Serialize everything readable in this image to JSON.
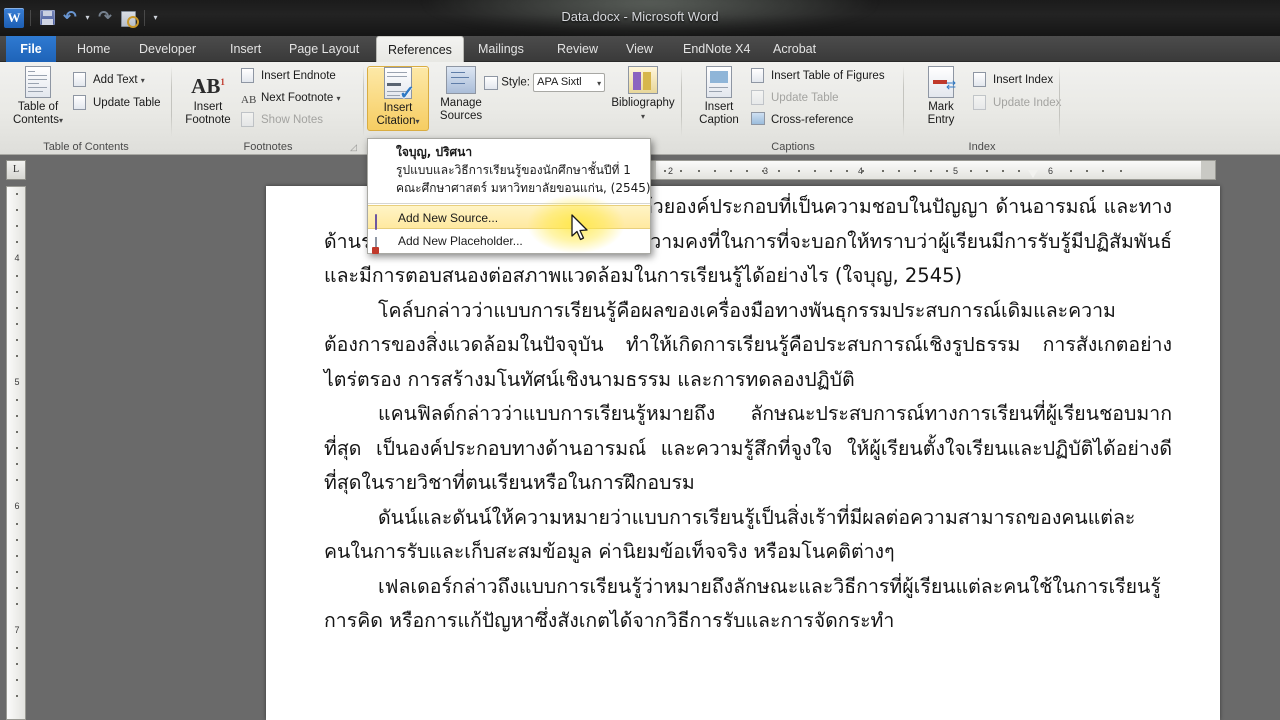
{
  "window": {
    "title": "Data.docx  -  Microsoft Word",
    "quick_access": [
      {
        "name": "word-logo",
        "label": "W"
      },
      {
        "name": "save-icon",
        "label": "Save"
      },
      {
        "name": "undo-icon",
        "label": "Undo"
      },
      {
        "name": "undo-dropdown-icon",
        "label": "▾"
      },
      {
        "name": "redo-icon",
        "label": "Redo"
      },
      {
        "name": "print-preview-icon",
        "label": "Print Preview"
      },
      {
        "name": "customize-qat-icon",
        "label": "▾"
      }
    ]
  },
  "tabs": [
    {
      "label": "File",
      "active": false,
      "file": true
    },
    {
      "label": "Home",
      "active": false
    },
    {
      "label": "Developer",
      "active": false
    },
    {
      "label": "Insert",
      "active": false
    },
    {
      "label": "Page Layout",
      "active": false
    },
    {
      "label": "References",
      "active": true
    },
    {
      "label": "Mailings",
      "active": false
    },
    {
      "label": "Review",
      "active": false
    },
    {
      "label": "View",
      "active": false
    },
    {
      "label": "EndNote X4",
      "active": false
    },
    {
      "label": "Acrobat",
      "active": false
    }
  ],
  "ribbon": {
    "groups": [
      {
        "name": "table-of-contents",
        "label": "Table of Contents",
        "big_buttons": [
          {
            "line1": "Table of",
            "line2": "Contents",
            "caret": "▾"
          }
        ],
        "small_buttons": [
          {
            "label": "Add Text",
            "caret": "▾",
            "disabled": false
          },
          {
            "label": "Update Table",
            "caret": "",
            "disabled": false
          }
        ]
      },
      {
        "name": "footnotes",
        "label": "Footnotes",
        "big_buttons": [
          {
            "line1": "Insert",
            "line2": "Footnote",
            "caret": ""
          }
        ],
        "small_buttons": [
          {
            "label": "Insert Endnote",
            "caret": "",
            "disabled": false
          },
          {
            "label": "Next Footnote",
            "caret": "▾",
            "disabled": false
          },
          {
            "label": "Show Notes",
            "caret": "",
            "disabled": true
          }
        ]
      },
      {
        "name": "citations-bibliography",
        "label": "Citations & Bibliography",
        "big_buttons": [
          {
            "line1": "Insert",
            "line2": "Citation",
            "caret": "▾",
            "highlighted": true
          },
          {
            "line1": "Manage",
            "line2": "Sources",
            "caret": ""
          },
          {
            "line1": "Bibliography",
            "line2": "",
            "caret": "▾"
          }
        ],
        "style_label": "Style:",
        "style_value": "APA Sixtl",
        "style_caret": "▾"
      },
      {
        "name": "captions",
        "label": "Captions",
        "big_buttons": [
          {
            "line1": "Insert",
            "line2": "Caption",
            "caret": ""
          }
        ],
        "small_buttons": [
          {
            "label": "Insert Table of Figures",
            "caret": "",
            "disabled": false
          },
          {
            "label": "Update Table",
            "caret": "",
            "disabled": true
          },
          {
            "label": "Cross-reference",
            "caret": "",
            "disabled": false
          }
        ]
      },
      {
        "name": "index",
        "label": "Index",
        "big_buttons": [
          {
            "line1": "Mark",
            "line2": "Entry",
            "caret": ""
          }
        ],
        "small_buttons": [
          {
            "label": "Insert Index",
            "caret": "",
            "disabled": false
          },
          {
            "label": "Update Index",
            "caret": "",
            "disabled": true
          }
        ]
      }
    ]
  },
  "menu": {
    "name": "insert-citation-menu",
    "source_entry": {
      "author": "ใจบุญ, ปริศนา",
      "title": "รูปแบบและวิธีการเรียนรู้ของนักศึกษาชั้นปีที่ 1",
      "publisher": "คณะศึกษาศาสตร์ มหาวิทยาลัยขอนแก่น, (2545)"
    },
    "items": [
      {
        "label": "Add New Source...",
        "selected": true,
        "icon": "new-source-icon"
      },
      {
        "label": "Add New Placeholder...",
        "selected": false,
        "icon": "new-placeholder-icon"
      }
    ]
  },
  "ruler": {
    "tab_selector": "L",
    "horizontal_marks": [
      "1",
      "2",
      "3",
      "4",
      "5",
      "6"
    ],
    "vertical_marks": [
      "4",
      "5",
      "6",
      "7"
    ]
  },
  "document": {
    "paragraphs": [
      "หมายว่าแบบการเรียนรู้ประกอบด้วยองค์ประกอบที่เป็นความชอบในปัญญา ด้านอารมณ์ และทางด้านร่างกาย เพื่อใช้เป็นตัวบ่งชี้ที่มีความคงที่ในการที่จะบอกให้ทราบว่าผู้เรียนมีการรับรู้มีปฏิสัมพันธ์ และมีการตอบสนองต่อสภาพแวดล้อมในการเรียนรู้ได้อย่างไร (ใจบุญ, 2545)",
      "โคล์บกล่าวว่าแบบการเรียนรู้คือผลของเครื่องมือทางพันธุกรรมประสบการณ์เดิมและความต้องการของสิ่งแวดล้อมในปัจจุบัน ทำให้เกิดการเรียนรู้คือประสบการณ์เชิงรูปธรรม การสังเกตอย่างไตร่ตรอง การสร้างมโนทัศน์เชิงนามธรรม และการทดลองปฏิบัติ",
      "แคนฟิลด์กล่าวว่าแบบการเรียนรู้หมายถึง ลักษณะประสบการณ์ทางการเรียนที่ผู้เรียนชอบมากที่สุด เป็นองค์ประกอบทางด้านอารมณ์ และความรู้สึกที่จูงใจ ให้ผู้เรียนตั้งใจเรียนและปฏิบัติได้อย่างดีที่สุดในรายวิชาที่ตนเรียนหรือในการฝึกอบรม",
      "ดันน์และดันน์ให้ความหมายว่าแบบการเรียนรู้เป็นสิ่งเร้าที่มีผลต่อความสามารถของคนแต่ละคนในการรับและเก็บสะสมข้อมูล ค่านิยมข้อเท็จจริง หรือมโนคติต่างๆ",
      "เฟลเดอร์กล่าวถึงแบบการเรียนรู้ว่าหมายถึงลักษณะและวิธีการที่ผู้เรียนแต่ละคนใช้ในการเรียนรู้ การคิด หรือการแก้ปัญหาซึ่งสังเกตได้จากวิธีการรับและการจัดกระทำ"
    ]
  },
  "colors": {
    "accent_blue": "#2f7ad1",
    "highlight_yellow": "#f6cd62",
    "menu_select": "#ffe9a0",
    "ribbon_bg": "#e9e9e5",
    "desktop_gray": "#6a6a6a"
  }
}
